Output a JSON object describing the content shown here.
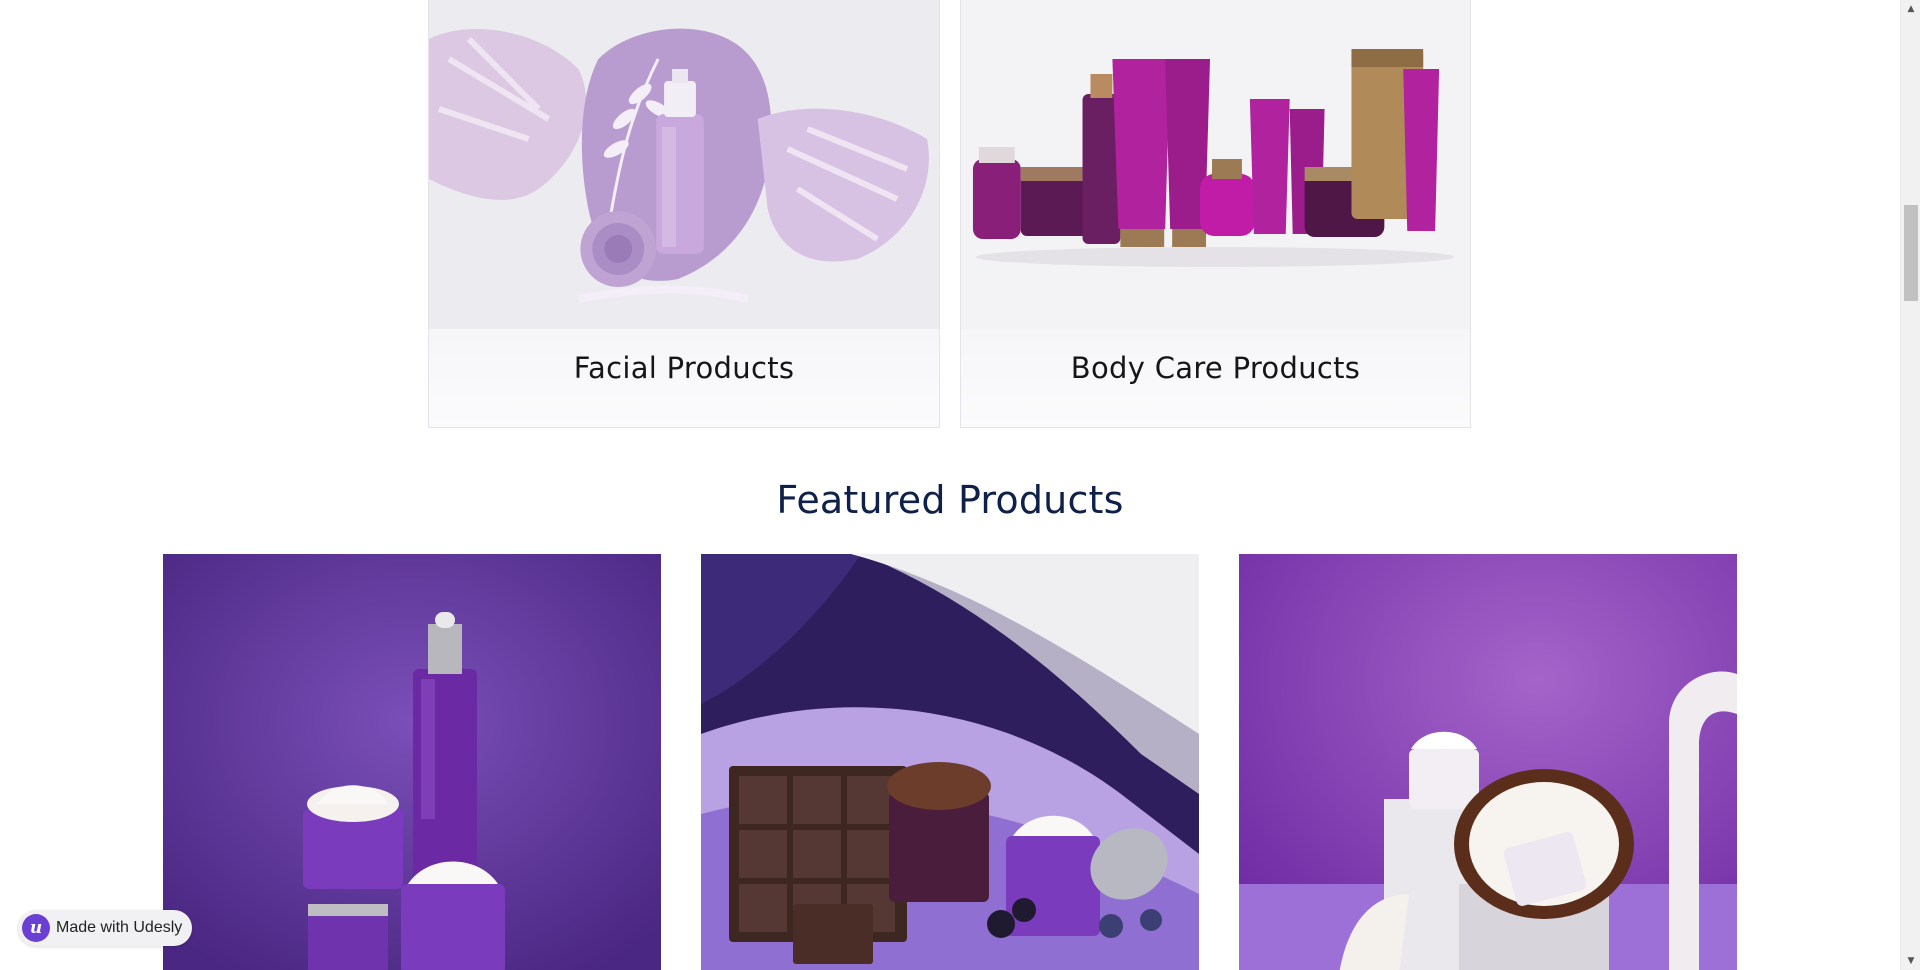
{
  "categories": [
    {
      "label": "Facial Products"
    },
    {
      "label": "Body Care Products"
    }
  ],
  "featured": {
    "title": "Featured Products"
  },
  "badge": {
    "logo_letter": "u",
    "text": "Made with Udesly"
  },
  "icons": {
    "scroll_up": "triangle-up-icon",
    "scroll_down": "triangle-down-icon"
  },
  "colors": {
    "heading": "#0f2148",
    "purple": "#6b2fa8",
    "badge_brand": "#6a3fd4"
  }
}
